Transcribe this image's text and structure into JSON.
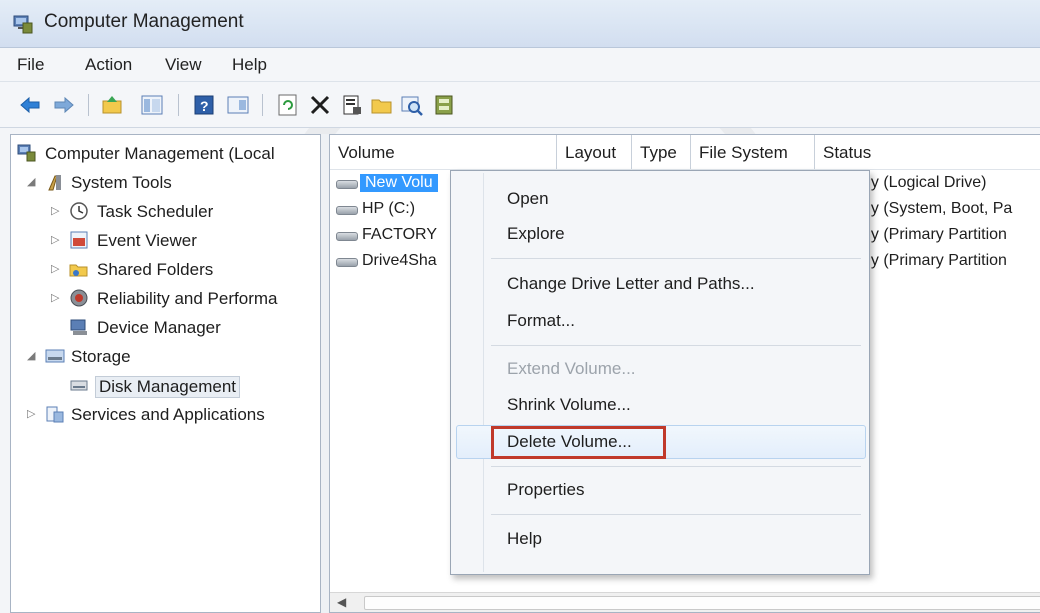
{
  "window": {
    "title": "Computer Management"
  },
  "menu": [
    {
      "name": "menu-file",
      "label": "File"
    },
    {
      "name": "menu-action",
      "label": "Action"
    },
    {
      "name": "menu-view",
      "label": "View"
    },
    {
      "name": "menu-help",
      "label": "Help"
    }
  ],
  "toolbar": {
    "buttons": [
      "back-icon",
      "forward-icon",
      "up-folder-icon",
      "show-hide-tree-icon",
      "help-icon",
      "properties-pane-icon",
      "refresh-icon",
      "delete-icon",
      "properties-icon",
      "open-folder-icon",
      "search-icon",
      "disk-properties-icon"
    ]
  },
  "tree": {
    "root": "Computer Management (Local",
    "system_tools": "System Tools",
    "task_scheduler": "Task Scheduler",
    "event_viewer": "Event Viewer",
    "shared_folders": "Shared Folders",
    "reliability": "Reliability and Performa",
    "device_manager": "Device Manager",
    "storage": "Storage",
    "disk_management": "Disk Management",
    "services": "Services and Applications"
  },
  "table": {
    "columns": [
      "Volume",
      "Layout",
      "Type",
      "File System",
      "Status"
    ],
    "rows": [
      {
        "volume": "New Volu",
        "status": "hy (Logical Drive)"
      },
      {
        "volume": "HP (C:)",
        "status": "hy (System, Boot, Pa"
      },
      {
        "volume": "FACTORY",
        "status": "hy (Primary Partition"
      },
      {
        "volume": "Drive4Sha",
        "status": "hy (Primary Partition"
      }
    ]
  },
  "context_menu": {
    "open": "Open",
    "explore": "Explore",
    "change_drive_letter": "Change Drive Letter and Paths...",
    "format": "Format...",
    "extend": "Extend Volume...",
    "shrink": "Shrink Volume...",
    "delete": "Delete Volume...",
    "properties": "Properties",
    "help": "Help"
  },
  "colors": {
    "selection": "#3399ff",
    "highlight_box": "#c0392b",
    "titlebar": "#d2def0"
  }
}
